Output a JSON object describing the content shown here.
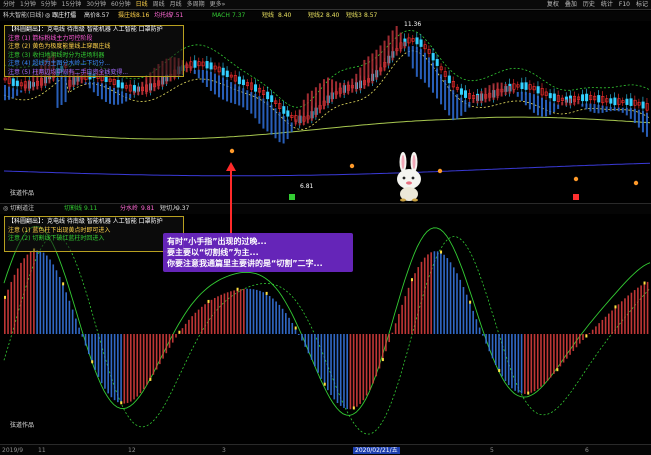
{
  "toolbar": {
    "timeframes": [
      {
        "label": "分时",
        "active": false
      },
      {
        "label": "1分钟",
        "active": false
      },
      {
        "label": "5分钟",
        "active": false
      },
      {
        "label": "15分钟",
        "active": false
      },
      {
        "label": "30分钟",
        "active": false
      },
      {
        "label": "60分钟",
        "active": false
      },
      {
        "label": "日线",
        "active": true
      },
      {
        "label": "周线",
        "active": false
      },
      {
        "label": "月线",
        "active": false
      },
      {
        "label": "多周期",
        "active": false
      },
      {
        "label": "更多»",
        "active": false
      }
    ],
    "right_buttons": [
      "复权",
      "叠加",
      "历史",
      "统计",
      "F10",
      "标记"
    ]
  },
  "infobar": {
    "stock": "科大智能(日线)",
    "indicator": "◎ 跟庄打擂",
    "high_label": "高价",
    "high_val": "8.57",
    "stop_label": "摄庄线",
    "stop_val": "8.16",
    "base_label": "均托线",
    "base_val": "7.51",
    "macd_label": "MACH",
    "macd_val": "7.37",
    "short_label": "短线",
    "short_val": "8.40",
    "mid_label": "短线2",
    "mid_val": "8.40",
    "buy_label": "短线3",
    "buy_val": "8.57"
  },
  "main_notes": {
    "title": "【科圆翻出】：克电线 待南级 智能机器 人工智能 口罩防护",
    "lines": [
      "注意  (1) 箭标粉线主力可控阶段",
      "注意  (2) 黄色为极度能量线上穿跟庄线",
      "注意  (3) 收扫地阴线时分为进场利器",
      "注意  (4) 超线为主图分水岭上下切分...",
      "注意  (5) 柱两边均中间有二手日资全线变得..."
    ]
  },
  "main_labels": {
    "price_top": "11.36",
    "price_low": "6.81",
    "watermark": "弦道作品"
  },
  "sub_header": {
    "name": "◎ 切割道注",
    "a_label": "切割线",
    "a_val": "9.11",
    "b_label": "分水岭",
    "b_val": "9.81",
    "c_label": "短切入",
    "c_val": "9.37"
  },
  "sub_notes": {
    "title": "【科圆翻出】：克电线 待南级 智能机器 人工智能 口罩防护",
    "lines": [
      "注意  (1) 蓝色柱下出现黄点时即可进入",
      "注意  (2) 切割线下破红蓝柱时回进入"
    ]
  },
  "caption": {
    "line1": "有时“小手指”出现的过晚...",
    "line2": "要主要以“切割线”为主...",
    "line3": "你要注意我通篇里主要讲的是“切割”二字..."
  },
  "sub_labels": {
    "watermark": "弦道作品"
  },
  "dates": {
    "d1": "2019/9",
    "d2": "11",
    "d3": "12",
    "d4": "3",
    "d5": "2020/02/21/五",
    "d6": "5",
    "d7": "6"
  },
  "colors": {
    "accent_yellow": "#ffd24a",
    "bar_red": "#e83a3a",
    "bar_blue": "#3a8cff",
    "line_green": "#33cc33",
    "line_yellow": "#e8e060",
    "line_blue": "#3a3ad8",
    "caption_purple": "#6e28c8"
  }
}
